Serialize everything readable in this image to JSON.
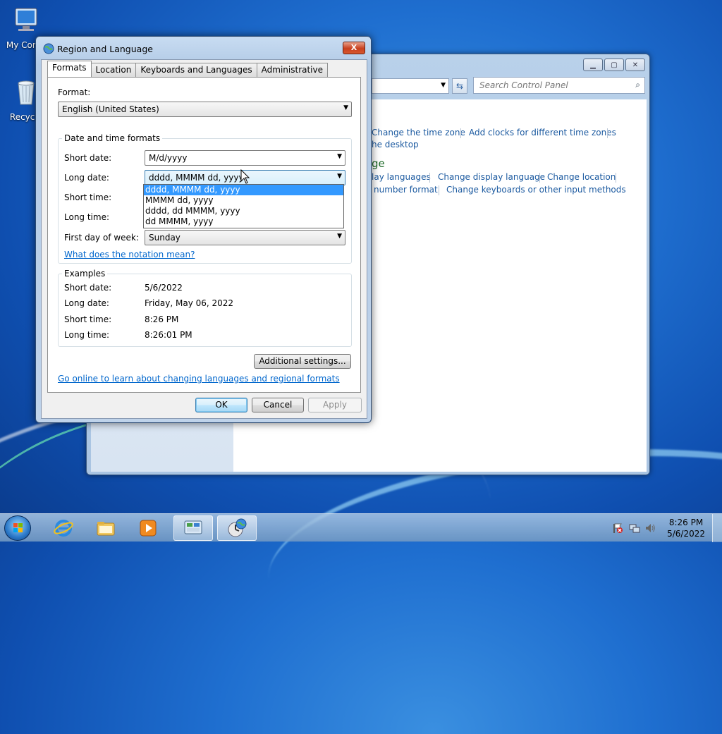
{
  "desktop": {
    "icons": [
      {
        "label": "My Comp",
        "icon": "computer-icon"
      },
      {
        "label": "Recycle",
        "icon": "recycle-bin-icon"
      }
    ]
  },
  "control_panel": {
    "search_placeholder": "Search Control Panel",
    "links_row1": [
      "Change the time zone",
      "Add clocks for different time zones"
    ],
    "link_desktop": "he desktop",
    "heading_partial": "ge",
    "links_row2": [
      "lay languages",
      "Change display language",
      "Change location"
    ],
    "links_row3": [
      "number format",
      "Change keyboards or other input methods"
    ]
  },
  "dialog": {
    "title": "Region and Language",
    "close_label": "X",
    "tabs": [
      "Formats",
      "Location",
      "Keyboards and Languages",
      "Administrative"
    ],
    "format_label": "Format:",
    "format_value": "English (United States)",
    "datetime_group_title": "Date and time formats",
    "short_date_label": "Short date:",
    "short_date_value": "M/d/yyyy",
    "long_date_label": "Long date:",
    "long_date_value": "dddd, MMMM dd, yyyy",
    "short_time_label": "Short time:",
    "long_time_label": "Long time:",
    "first_day_label": "First day of week:",
    "first_day_value": "Sunday",
    "notation_link": "What does the notation mean?",
    "long_date_options": [
      "dddd, MMMM dd, yyyy",
      "MMMM dd, yyyy",
      "dddd, dd MMMM, yyyy",
      "dd MMMM, yyyy"
    ],
    "examples_title": "Examples",
    "examples": [
      {
        "label": "Short date:",
        "value": "5/6/2022"
      },
      {
        "label": "Long date:",
        "value": "Friday, May 06, 2022"
      },
      {
        "label": "Short time:",
        "value": "8:26 PM"
      },
      {
        "label": "Long time:",
        "value": "8:26:01 PM"
      }
    ],
    "additional_settings": "Additional settings...",
    "online_link": "Go online to learn about changing languages and regional formats",
    "ok": "OK",
    "cancel": "Cancel",
    "apply": "Apply"
  },
  "taskbar": {
    "clock_time": "8:26 PM",
    "clock_date": "5/6/2022"
  }
}
